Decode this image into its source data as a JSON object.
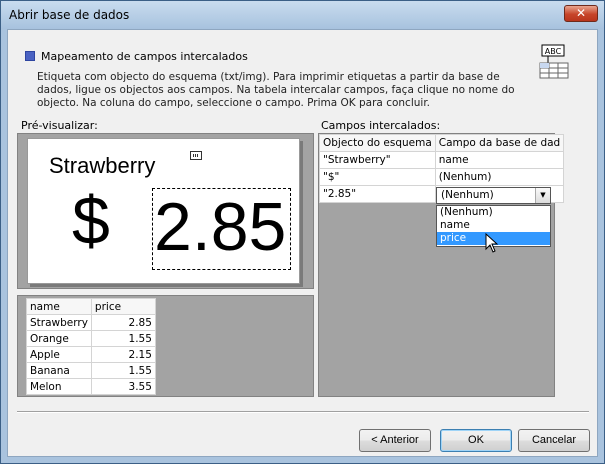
{
  "window": {
    "title": "Abrir base de dados",
    "close_label": "✕"
  },
  "header": {
    "title": "Mapeamento de campos intercalados",
    "description": "Etiqueta com objecto do esquema (txt/img). Para imprimir etiquetas a partir da base de dados, ligue os objectos aos campos. Na tabela intercalar campos, faça clique no nome do objecto. Na coluna do campo, seleccione o campo. Prima OK para concluir.",
    "icon": "abc-database-icon",
    "icon_text": "ABC"
  },
  "preview": {
    "label": "Pré-visualizar:",
    "text_object": "Strawberry",
    "currency": "$",
    "price": "2.85"
  },
  "data_table": {
    "columns": [
      "name",
      "price"
    ],
    "rows": [
      [
        "Strawberry",
        "2.85"
      ],
      [
        "Orange",
        "1.55"
      ],
      [
        "Apple",
        "2.15"
      ],
      [
        "Banana",
        "1.55"
      ],
      [
        "Melon",
        "3.55"
      ]
    ]
  },
  "fields": {
    "label": "Campos intercalados:",
    "columns": [
      "Objecto do esquema",
      "Campo da base de dad"
    ],
    "rows": [
      [
        "\"Strawberry\"",
        "name"
      ],
      [
        "\"$\"",
        "(Nenhum)"
      ],
      [
        "\"2.85\"",
        ""
      ]
    ],
    "dropdown_value": "(Nenhum)",
    "dropdown_options": [
      "(Nenhum)",
      "name",
      "price"
    ],
    "dropdown_selected": "price"
  },
  "buttons": {
    "back": "< Anterior",
    "ok": "OK",
    "cancel": "Cancelar"
  }
}
